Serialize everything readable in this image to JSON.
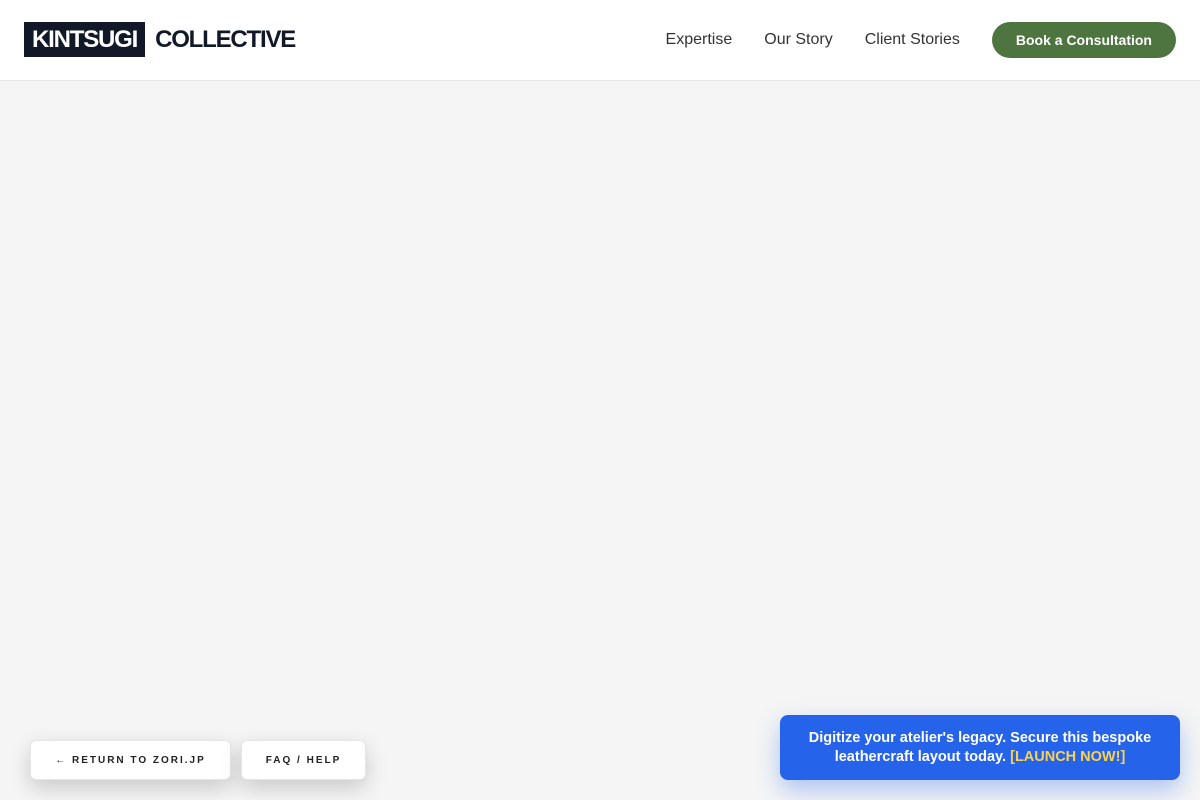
{
  "header": {
    "logo_highlight": "KINTSUGI",
    "logo_rest": "COLLECTIVE",
    "nav": [
      {
        "label": "Expertise"
      },
      {
        "label": "Our Story"
      },
      {
        "label": "Client Stories"
      }
    ],
    "cta_label": "Book a Consultation"
  },
  "footer_buttons": {
    "return_label": "← RETURN TO ZORI.JP",
    "faq_label": "FAQ / HELP"
  },
  "promo": {
    "text": "Digitize your atelier's legacy. Secure this bespoke leathercraft layout today.",
    "link_label": "[LAUNCH NOW!]"
  },
  "colors": {
    "page_background": "#f5f5f5",
    "header_background": "#ffffff",
    "logo_box": "#111827",
    "cta_green": "#4e7440",
    "promo_blue": "#2563eb",
    "promo_link_yellow": "#fcd34d"
  }
}
